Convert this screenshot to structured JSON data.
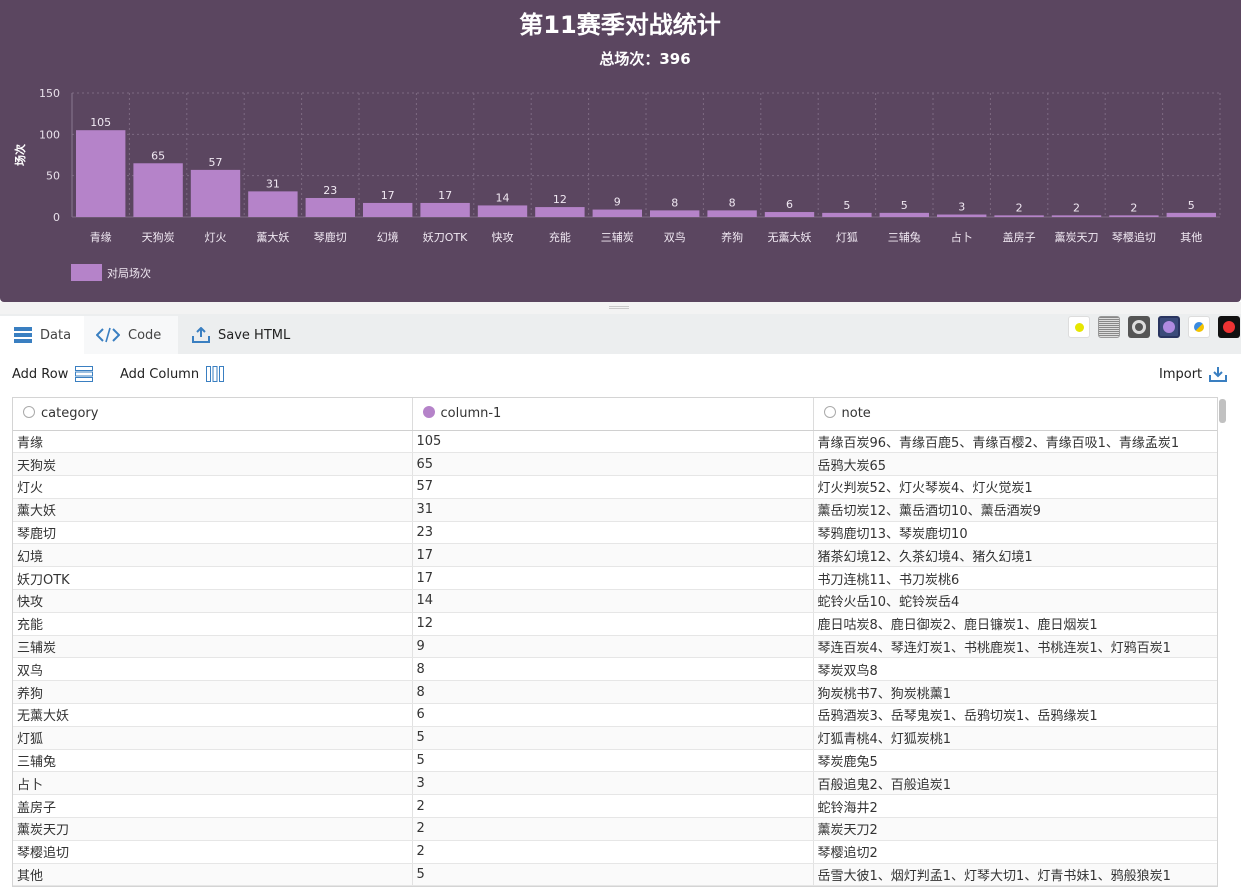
{
  "chart_data": {
    "type": "bar",
    "title": "第11赛季对战统计",
    "subtitle": "总场次：396",
    "ylabel": "场次",
    "ylim": [
      0,
      150
    ],
    "yticks": [
      0,
      50,
      100,
      150
    ],
    "categories": [
      "青缘",
      "天狗炭",
      "灯火",
      "薰大妖",
      "琴鹿切",
      "幻境",
      "妖刀OTK",
      "快攻",
      "充能",
      "三辅炭",
      "双鸟",
      "养狗",
      "无薰大妖",
      "灯狐",
      "三辅兔",
      "占卜",
      "盖房子",
      "薰炭天刀",
      "琴樱追切",
      "其他"
    ],
    "series": [
      {
        "name": "对局场次",
        "values": [
          105,
          65,
          57,
          31,
          23,
          17,
          17,
          14,
          12,
          9,
          8,
          8,
          6,
          5,
          5,
          3,
          2,
          2,
          2,
          5
        ]
      }
    ],
    "grid": true,
    "legend": "bottom-left",
    "colors": {
      "bar": "#b583c9",
      "background": "#5b4660"
    }
  },
  "toolbar": {
    "tabs": [
      {
        "label": "Data",
        "icon": "table-icon"
      },
      {
        "label": "Code",
        "icon": "code-icon"
      }
    ],
    "save_label": "Save HTML",
    "themes": [
      "yellow-dot-theme",
      "striped-theme",
      "ring-theme",
      "purple-orb-theme",
      "blue-yellow-theme",
      "red-dot-theme"
    ]
  },
  "actions": {
    "add_row": "Add Row",
    "add_column": "Add Column",
    "import": "Import"
  },
  "table": {
    "columns": [
      "category",
      "column-1",
      "note"
    ],
    "rows": [
      [
        "青缘",
        "105",
        "青缘百炭96、青缘百鹿5、青缘百樱2、青缘百吸1、青缘孟炭1"
      ],
      [
        "天狗炭",
        "65",
        "岳鸦大炭65"
      ],
      [
        "灯火",
        "57",
        "灯火判炭52、灯火琴炭4、灯火觉炭1"
      ],
      [
        "薰大妖",
        "31",
        "薰岳切炭12、薰岳酒切10、薰岳酒炭9"
      ],
      [
        "琴鹿切",
        "23",
        "琴鸦鹿切13、琴炭鹿切10"
      ],
      [
        "幻境",
        "17",
        "猪茶幻境12、久茶幻境4、猪久幻境1"
      ],
      [
        "妖刀OTK",
        "17",
        "书刀连桃11、书刀炭桃6"
      ],
      [
        "快攻",
        "14",
        "蛇铃火岳10、蛇铃炭岳4"
      ],
      [
        "充能",
        "12",
        "鹿日咕炭8、鹿日御炭2、鹿日镰炭1、鹿日烟炭1"
      ],
      [
        "三辅炭",
        "9",
        "琴连百炭4、琴连灯炭1、书桃鹿炭1、书桃连炭1、灯鸦百炭1"
      ],
      [
        "双鸟",
        "8",
        "琴炭双鸟8"
      ],
      [
        "养狗",
        "8",
        "狗炭桃书7、狗炭桃薰1"
      ],
      [
        "无薰大妖",
        "6",
        "岳鸦酒炭3、岳琴鬼炭1、岳鸦切炭1、岳鸦缘炭1"
      ],
      [
        "灯狐",
        "5",
        "灯狐青桃4、灯狐炭桃1"
      ],
      [
        "三辅兔",
        "5",
        "琴炭鹿兔5"
      ],
      [
        "占卜",
        "3",
        "百般追鬼2、百般追炭1"
      ],
      [
        "盖房子",
        "2",
        "蛇铃海井2"
      ],
      [
        "薰炭天刀",
        "2",
        "薰炭天刀2"
      ],
      [
        "琴樱追切",
        "2",
        "琴樱追切2"
      ],
      [
        "其他",
        "5",
        "岳雪大彼1、烟灯判孟1、灯琴大切1、灯青书妹1、鸦般狼炭1"
      ]
    ]
  }
}
